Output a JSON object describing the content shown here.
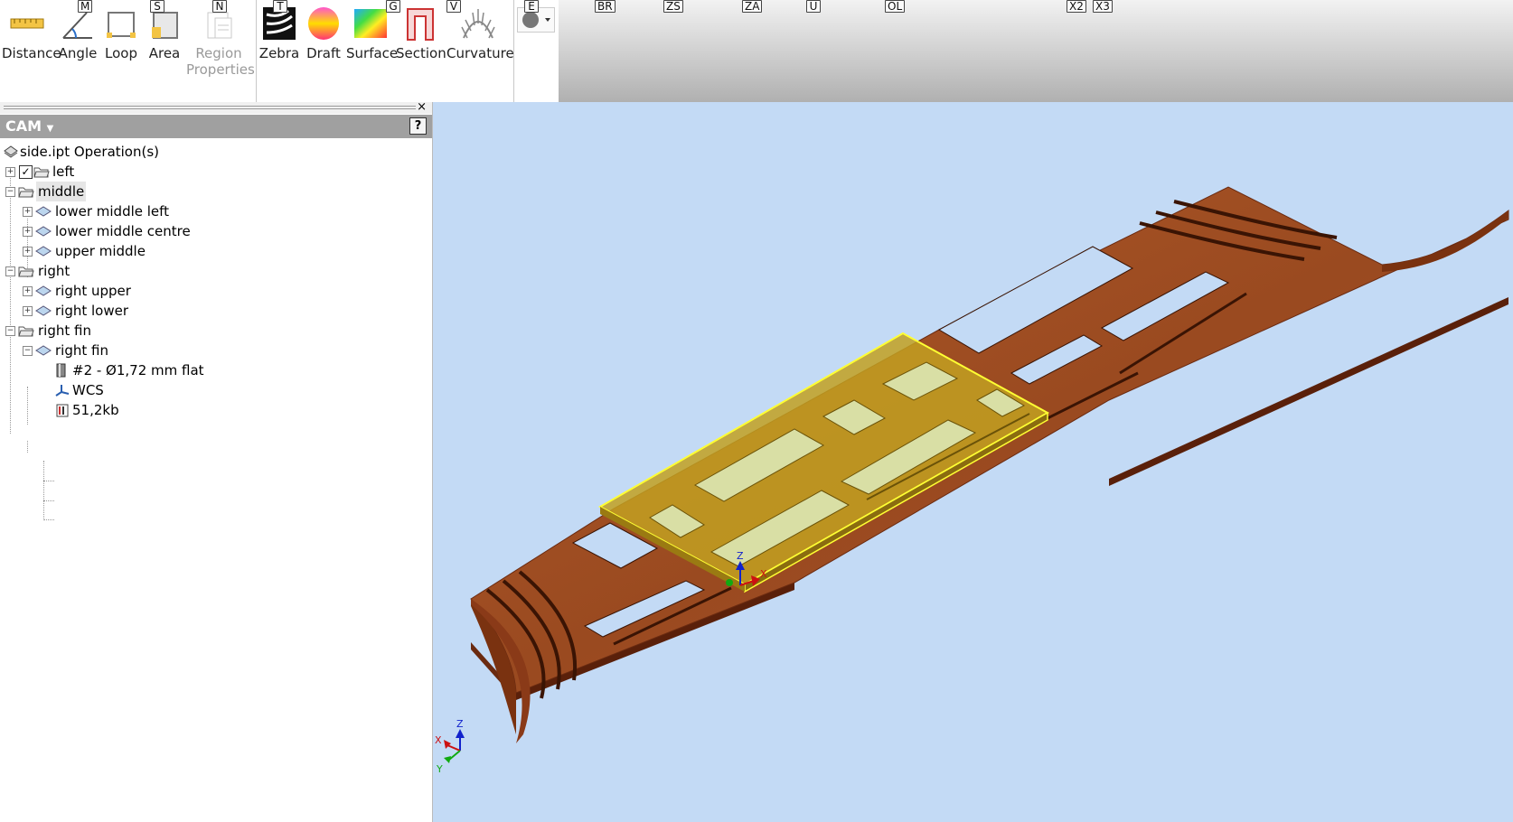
{
  "ribbon": {
    "tools": [
      {
        "label": "Distance",
        "icon": "ruler-icon",
        "key": ""
      },
      {
        "label": "Angle",
        "icon": "protractor-icon",
        "key": "M"
      },
      {
        "label": "Loop",
        "icon": "loop-icon",
        "key": "S"
      },
      {
        "label": "Area",
        "icon": "area-icon",
        "key": "N"
      },
      {
        "label": "Region\nProperties",
        "icon": "region-properties-icon",
        "key": ""
      },
      {
        "label": "Zebra",
        "icon": "zebra-icon",
        "key": "T"
      },
      {
        "label": "Draft",
        "icon": "draft-icon",
        "key": "G"
      },
      {
        "label": "Surface",
        "icon": "surface-icon",
        "key": "V"
      },
      {
        "label": "Section",
        "icon": "section-icon",
        "key": ""
      },
      {
        "label": "Curvature",
        "icon": "curvature-icon",
        "key": "E"
      }
    ],
    "keytips": [
      "BR",
      "ZS",
      "ZA",
      "U",
      "OL",
      "X2",
      "X3"
    ]
  },
  "panel": {
    "title": "CAM",
    "help": "?",
    "close": "×",
    "tree": [
      {
        "label": "side.ipt Operation(s)",
        "level": 0,
        "icon": "part-icon"
      },
      {
        "label": "left",
        "level": 0,
        "icon": "folder-icon",
        "expand": "+",
        "checkbox": true
      },
      {
        "label": "middle",
        "level": 0,
        "icon": "folder-icon",
        "expand": "−",
        "selected": true
      },
      {
        "label": "lower middle left",
        "level": 1,
        "icon": "operation-icon",
        "expand": "+"
      },
      {
        "label": "lower middle centre",
        "level": 1,
        "icon": "operation-icon",
        "expand": "+"
      },
      {
        "label": "upper middle",
        "level": 1,
        "icon": "operation-icon",
        "expand": "+"
      },
      {
        "label": "right",
        "level": 0,
        "icon": "folder-icon",
        "expand": "−"
      },
      {
        "label": "right upper",
        "level": 1,
        "icon": "operation-icon",
        "expand": "+"
      },
      {
        "label": "right lower",
        "level": 1,
        "icon": "operation-icon",
        "expand": "+"
      },
      {
        "label": "right fin",
        "level": 0,
        "icon": "folder-icon",
        "expand": "−"
      },
      {
        "label": "right fin",
        "level": 1,
        "icon": "operation-icon",
        "expand": "−"
      },
      {
        "label": "#2 - Ø1,72 mm flat",
        "level": 2,
        "icon": "tool-icon"
      },
      {
        "label": "WCS",
        "level": 2,
        "icon": "wcs-icon"
      },
      {
        "label": "51,2kb",
        "level": 2,
        "icon": "nc-file-icon"
      }
    ]
  },
  "viewport": {
    "axis_x": "X",
    "axis_y": "Y",
    "axis_z": "Z",
    "colors": {
      "background": "#c3daf5",
      "wood": "#9a4a20",
      "selection": "#c2a021",
      "selection_outline": "#ffff33"
    }
  }
}
